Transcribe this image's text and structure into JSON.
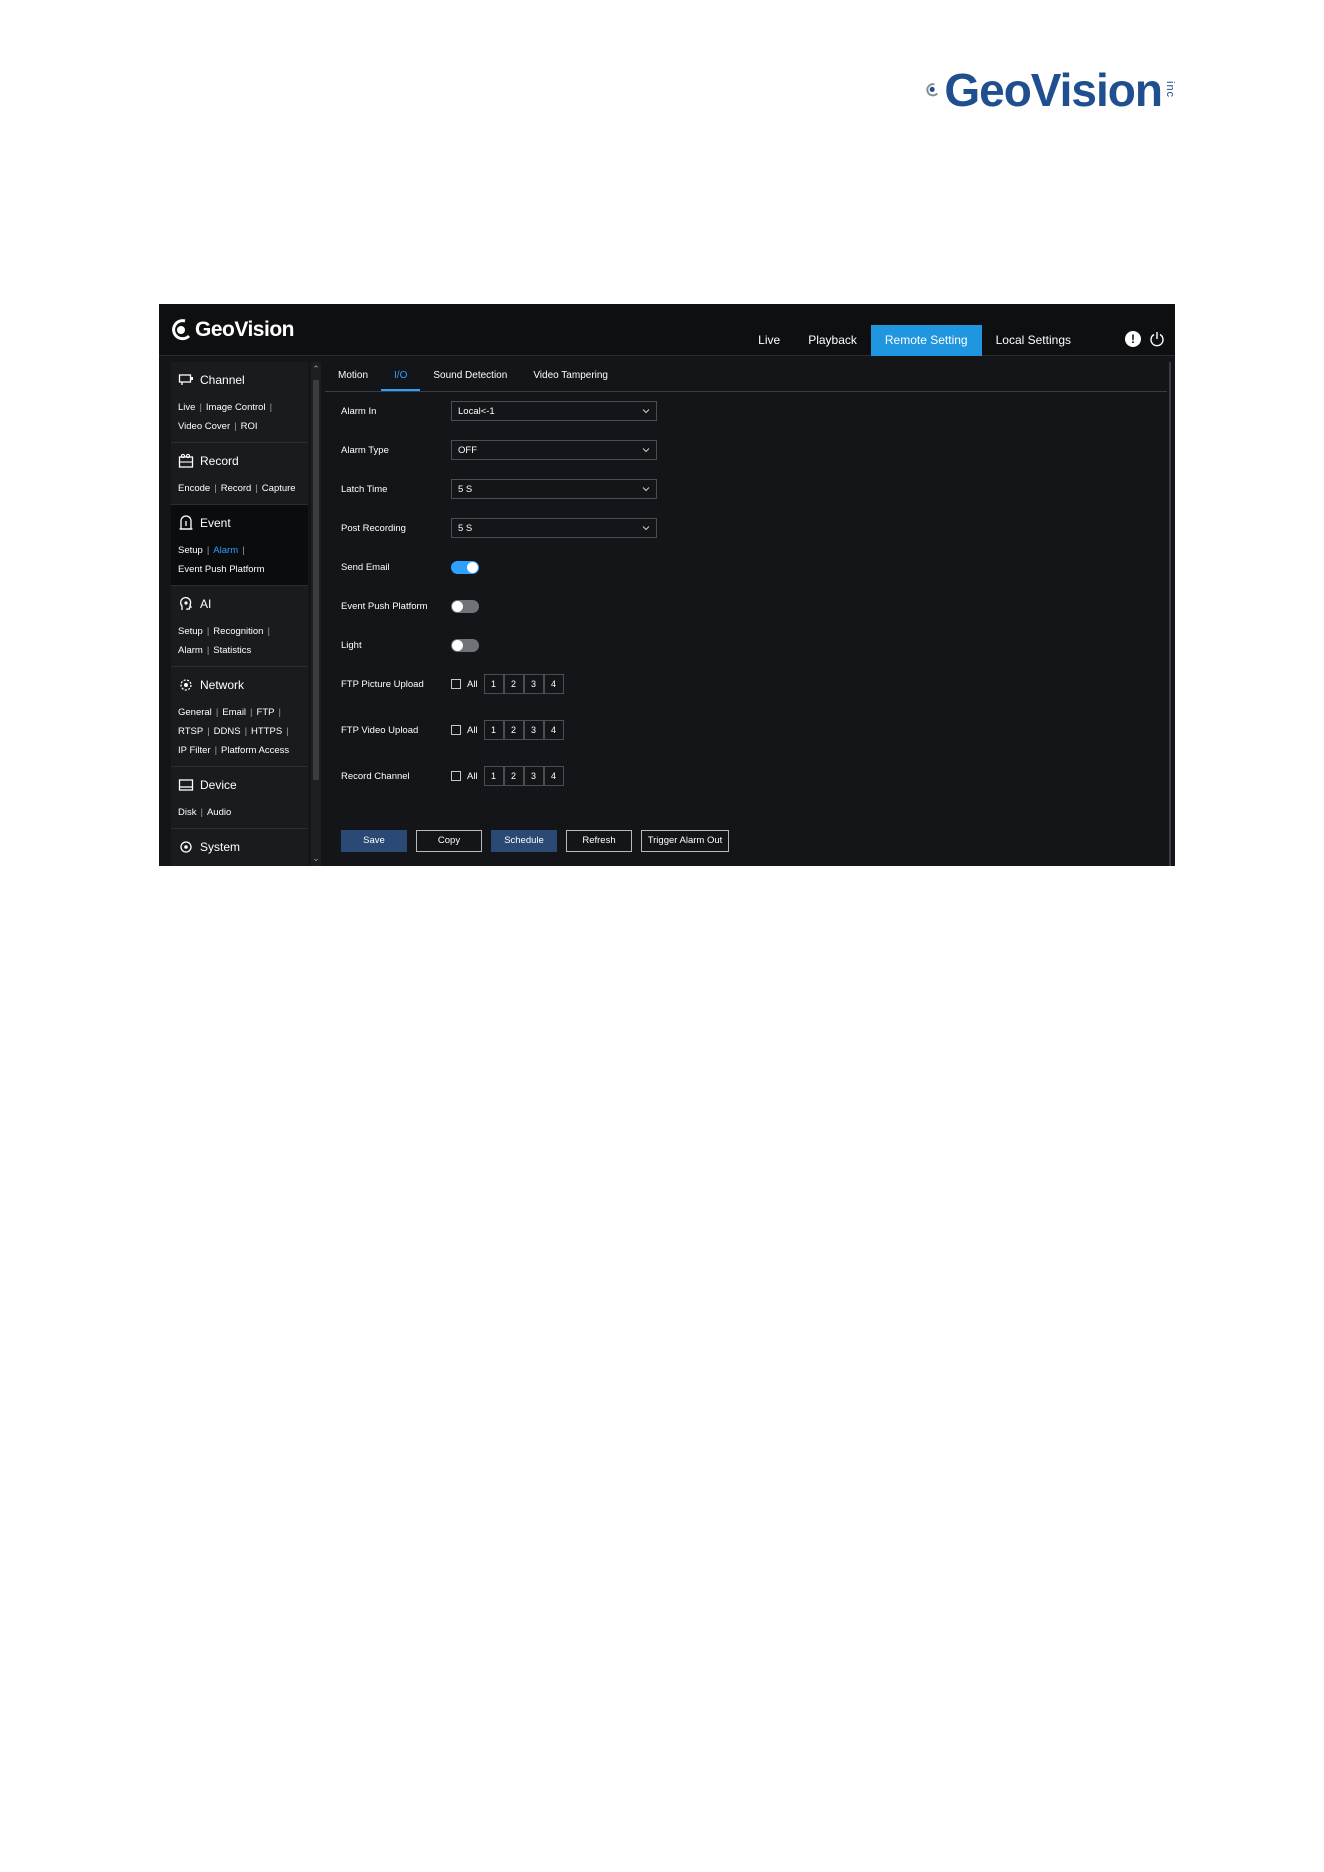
{
  "page_logo": {
    "brand": "GeoVision",
    "suffix": "inc"
  },
  "app": {
    "logo": "GeoVision",
    "nav": [
      "Live",
      "Playback",
      "Remote Setting",
      "Local Settings"
    ],
    "active_nav": "Remote Setting",
    "info_icon": "!",
    "accent_color": "#2196e0"
  },
  "sidebar": {
    "channel": {
      "title": "Channel",
      "icon": "monitor-icon",
      "links": [
        "Live",
        "Image Control",
        "Video Cover",
        "ROI"
      ]
    },
    "record": {
      "title": "Record",
      "icon": "record-icon",
      "links": [
        "Encode",
        "Record",
        "Capture"
      ]
    },
    "event": {
      "title": "Event",
      "icon": "alarm-icon",
      "links": [
        "Setup",
        "Alarm",
        "Event Push Platform"
      ],
      "active_link": "Alarm"
    },
    "ai": {
      "title": "AI",
      "icon": "ai-icon",
      "links": [
        "Setup",
        "Recognition",
        "Alarm",
        "Statistics"
      ]
    },
    "network": {
      "title": "Network",
      "icon": "network-icon",
      "links": [
        "General",
        "Email",
        "FTP",
        "RTSP",
        "DDNS",
        "HTTPS",
        "IP Filter",
        "Platform Access"
      ]
    },
    "device": {
      "title": "Device",
      "icon": "device-icon",
      "links": [
        "Disk",
        "Audio"
      ]
    },
    "system": {
      "title": "System",
      "icon": "system-icon"
    }
  },
  "tabs": [
    "Motion",
    "I/O",
    "Sound Detection",
    "Video Tampering"
  ],
  "active_tab": "I/O",
  "form": {
    "alarm_in": {
      "label": "Alarm In",
      "value": "Local<-1"
    },
    "alarm_type": {
      "label": "Alarm Type",
      "value": "OFF"
    },
    "latch_time": {
      "label": "Latch Time",
      "value": "5 S"
    },
    "post_recording": {
      "label": "Post Recording",
      "value": "5 S"
    },
    "send_email": {
      "label": "Send Email",
      "on": true
    },
    "event_push_platform": {
      "label": "Event Push Platform",
      "on": false
    },
    "light": {
      "label": "Light",
      "on": false
    },
    "ftp_picture_upload": {
      "label": "FTP Picture Upload",
      "all": "All",
      "channels": [
        "1",
        "2",
        "3",
        "4"
      ]
    },
    "ftp_video_upload": {
      "label": "FTP Video Upload",
      "all": "All",
      "channels": [
        "1",
        "2",
        "3",
        "4"
      ]
    },
    "record_channel": {
      "label": "Record Channel",
      "all": "All",
      "channels": [
        "1",
        "2",
        "3",
        "4"
      ]
    }
  },
  "buttons": {
    "save": "Save",
    "copy": "Copy",
    "schedule": "Schedule",
    "refresh": "Refresh",
    "trigger": "Trigger Alarm Out"
  }
}
